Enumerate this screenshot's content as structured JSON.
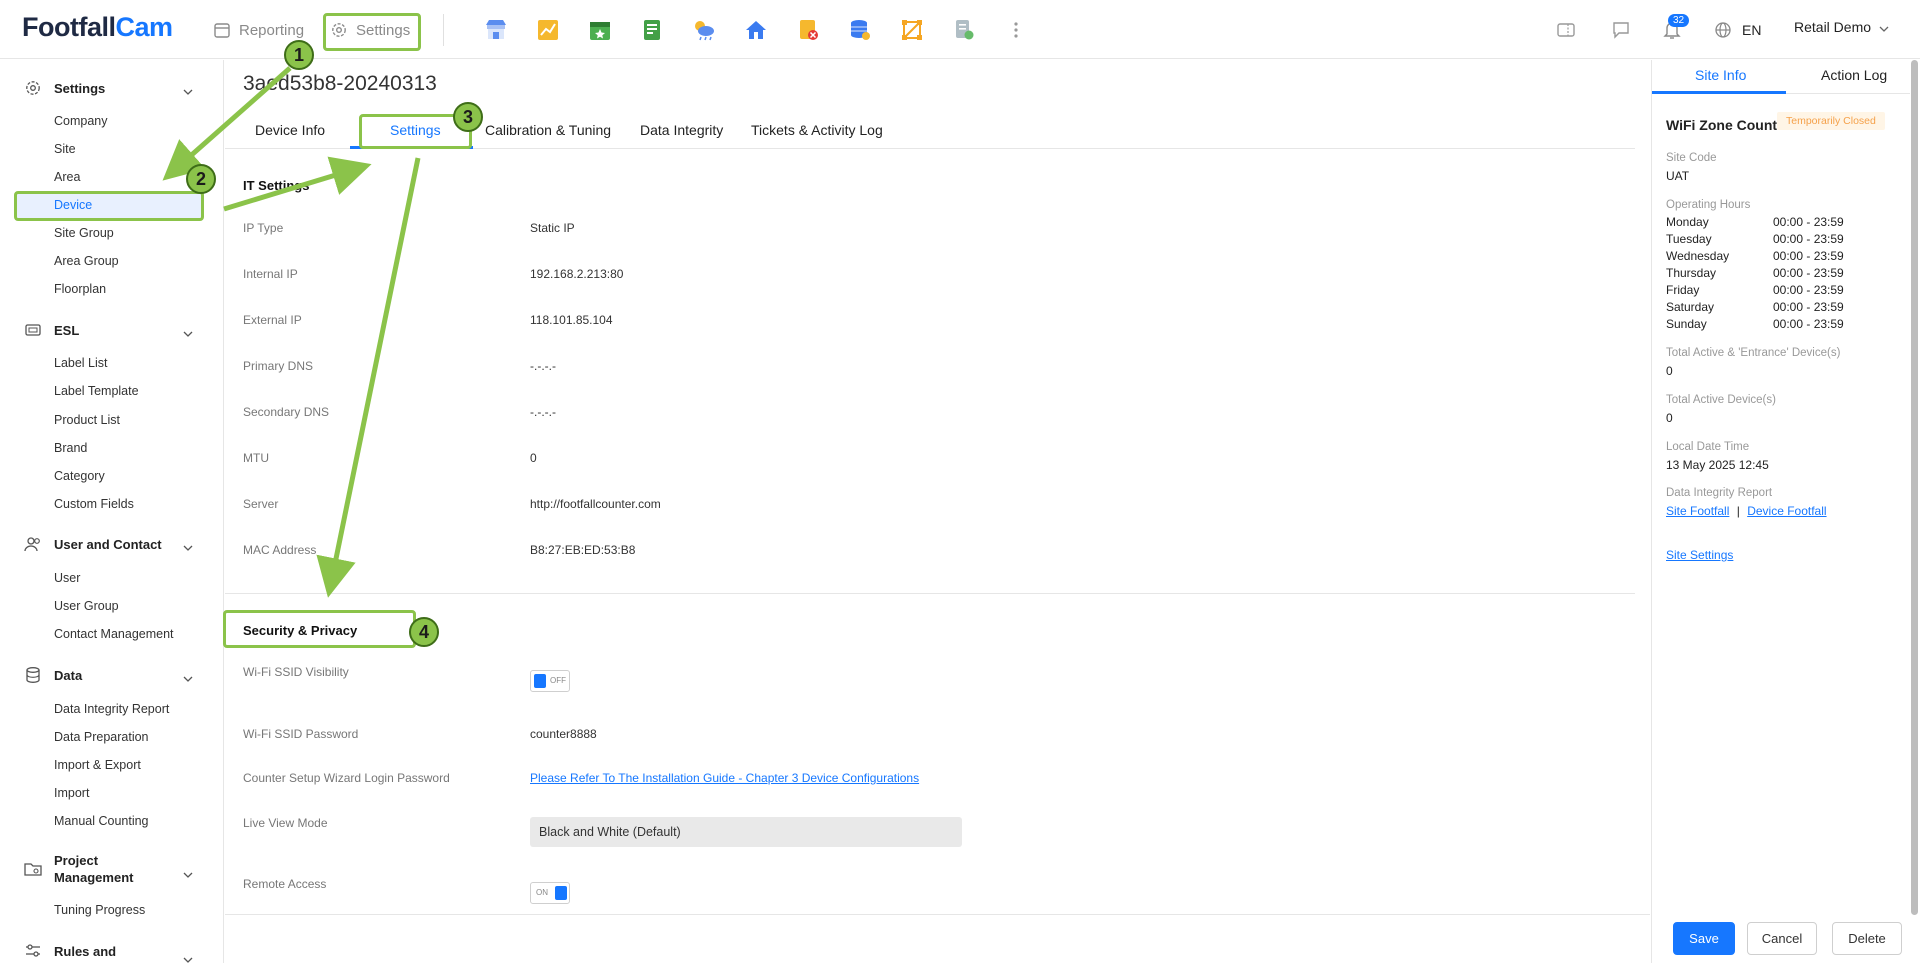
{
  "logo": {
    "part1": "Footfall",
    "part2": "Cam"
  },
  "topnav": {
    "reporting": "Reporting",
    "settings": "Settings"
  },
  "toolbar_icons": [
    "store-icon",
    "chart-icon",
    "calendar-icon",
    "report-icon",
    "weather-icon",
    "home-icon",
    "alert-file-icon",
    "database-icon",
    "zone-icon",
    "export-icon",
    "more-icon"
  ],
  "header_right": {
    "notification_count": "32",
    "language": "EN",
    "user": "Retail Demo"
  },
  "sidebar": {
    "settings": {
      "title": "Settings",
      "items": [
        "Company",
        "Site",
        "Area",
        "Device",
        "Site Group",
        "Area Group",
        "Floorplan"
      ]
    },
    "esl": {
      "title": "ESL",
      "items": [
        "Label List",
        "Label Template",
        "Product List",
        "Brand",
        "Category",
        "Custom Fields"
      ]
    },
    "user_contact": {
      "title": "User and Contact",
      "items": [
        "User",
        "User Group",
        "Contact Management"
      ]
    },
    "data": {
      "title": "Data",
      "items": [
        "Data Integrity Report",
        "Data Preparation",
        "Import & Export",
        "Import",
        "Manual Counting"
      ]
    },
    "project": {
      "title_line1": "Project",
      "title_line2": "Management",
      "items": [
        "Tuning Progress"
      ]
    },
    "rules": {
      "title": "Rules and"
    }
  },
  "main": {
    "title": "3aed53b8-20240313",
    "tabs": [
      "Device Info",
      "Settings",
      "Calibration & Tuning",
      "Data Integrity",
      "Tickets & Activity Log"
    ],
    "it_settings": {
      "title": "IT Settings",
      "rows": [
        {
          "label": "IP Type",
          "value": "Static IP"
        },
        {
          "label": "Internal IP",
          "value": "192.168.2.213:80"
        },
        {
          "label": "External IP",
          "value": "118.101.85.104"
        },
        {
          "label": "Primary DNS",
          "value": "-.-.-.-"
        },
        {
          "label": "Secondary DNS",
          "value": "-.-.-.-"
        },
        {
          "label": "MTU",
          "value": "0"
        },
        {
          "label": "Server",
          "value": "http://footfallcounter.com"
        },
        {
          "label": "MAC Address",
          "value": "B8:27:EB:ED:53:B8"
        }
      ]
    },
    "security": {
      "title": "Security & Privacy",
      "ssid_visibility_label": "Wi-Fi SSID Visibility",
      "ssid_visibility_state": "OFF",
      "ssid_password_label": "Wi-Fi SSID Password",
      "ssid_password_value": "counter8888",
      "wizard_label": "Counter Setup Wizard Login Password",
      "wizard_link": "Please Refer To The Installation Guide - Chapter 3 Device Configurations",
      "live_view_label": "Live View Mode",
      "live_view_value": "Black and White (Default)",
      "remote_label": "Remote Access",
      "remote_state": "ON"
    },
    "buttons": {
      "save": "Save",
      "cancel": "Cancel",
      "delete": "Delete"
    }
  },
  "right_panel": {
    "tabs": [
      "Site Info",
      "Action Log"
    ],
    "zone_title": "WiFi Zone Count",
    "status": "Temporarily Closed",
    "site_code_label": "Site Code",
    "site_code": "UAT",
    "hours_label": "Operating Hours",
    "hours": [
      {
        "day": "Monday",
        "time": "00:00 - 23:59"
      },
      {
        "day": "Tuesday",
        "time": "00:00 - 23:59"
      },
      {
        "day": "Wednesday",
        "time": "00:00 - 23:59"
      },
      {
        "day": "Thursday",
        "time": "00:00 - 23:59"
      },
      {
        "day": "Friday",
        "time": "00:00 - 23:59"
      },
      {
        "day": "Saturday",
        "time": "00:00 - 23:59"
      },
      {
        "day": "Sunday",
        "time": "00:00 - 23:59"
      }
    ],
    "active_entrance_label": "Total Active & 'Entrance' Device(s)",
    "active_entrance": "0",
    "active_label": "Total Active Device(s)",
    "active": "0",
    "local_time_label": "Local Date Time",
    "local_time": "13 May 2025 12:45",
    "integrity_label": "Data Integrity Report",
    "site_footfall": "Site Footfall",
    "separator": "|",
    "device_footfall": "Device Footfall",
    "site_settings": "Site Settings"
  },
  "annotations": {
    "step1": "1",
    "step2": "2",
    "step3": "3",
    "step4": "4",
    "accent": "#8bc34a"
  }
}
